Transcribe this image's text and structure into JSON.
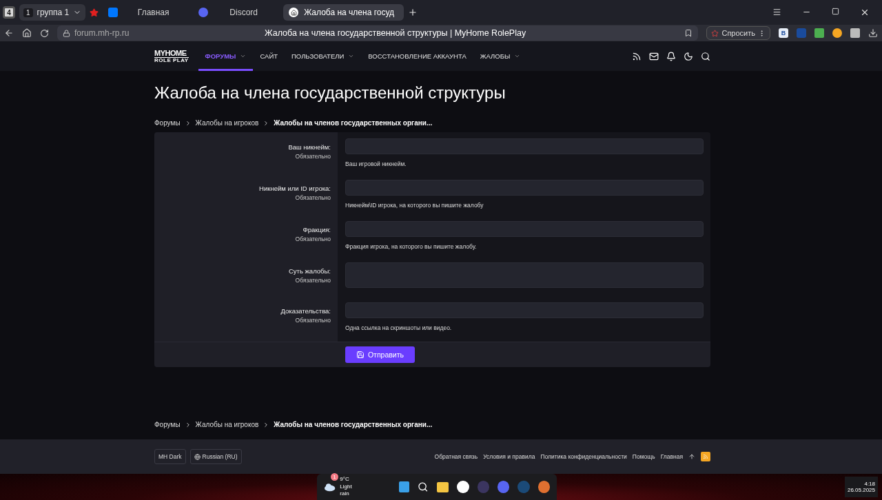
{
  "browser": {
    "tab_count": "4",
    "group": {
      "number": "1",
      "label": "группа 1"
    },
    "tabs": [
      {
        "label": "Главная",
        "selected": false
      },
      {
        "label": "Discord",
        "selected": false
      },
      {
        "label": "Жалоба на члена госуд",
        "selected": true
      }
    ],
    "url": "forum.mh-rp.ru",
    "page_title": "Жалоба на члена государственной структуры | MyHome RolePlay",
    "ask_button": "Спросить",
    "extension_badge": "B"
  },
  "site_nav": {
    "logo_top": "MYHOME",
    "logo_bottom": "ROLE PLAY",
    "items": [
      {
        "label": "ФОРУМЫ",
        "selected": true,
        "dropdown": true
      },
      {
        "label": "САЙТ",
        "selected": false,
        "dropdown": false
      },
      {
        "label": "ПОЛЬЗОВАТЕЛИ",
        "selected": false,
        "dropdown": true
      },
      {
        "label": "ВОССТАНОВЛЕНИЕ АККАУНТА",
        "selected": false,
        "dropdown": false
      },
      {
        "label": "ЖАЛОБЫ",
        "selected": false,
        "dropdown": true
      }
    ]
  },
  "page": {
    "title": "Жалоба на члена государственной структуры",
    "breadcrumbs": [
      "Форумы",
      "Жалобы на игроков",
      "Жалобы на членов государственных органи..."
    ],
    "form": {
      "fields": [
        {
          "label": "Ваш никнейм:",
          "required": "Обязательно",
          "kind": "input",
          "hint": "Ваш игровой никнейм."
        },
        {
          "label": "Никнейм или ID игрока:",
          "required": "Обязательно",
          "kind": "input",
          "hint": "Никнейм\\ID игрока, на которого вы пишите жалобу"
        },
        {
          "label": "Фракция:",
          "required": "Обязательно",
          "kind": "input",
          "hint": "Фракция игрока, на которого вы пишите жалобу."
        },
        {
          "label": "Суть жалобы:",
          "required": "Обязательно",
          "kind": "textarea"
        },
        {
          "label": "Доказательства:",
          "required": "Обязательно",
          "kind": "input",
          "hint": "Одна ссылка на скриншоты или видео."
        }
      ],
      "submit": "Отправить"
    },
    "bottom_breadcrumbs": [
      "Форумы",
      "Жалобы на игроков",
      "Жалобы на членов государственных органи..."
    ]
  },
  "footer": {
    "style_button": "MH Dark",
    "language_button": "Russian (RU)",
    "links": [
      "Обратная связь",
      "Условия и правила",
      "Политика конфиденциальности",
      "Помощь",
      "Главная"
    ]
  },
  "taskbar": {
    "weather": {
      "badge": "1",
      "temperature": "9°C",
      "condition": "Light rain"
    },
    "time": "4:18",
    "date": "26.05.2025"
  }
}
